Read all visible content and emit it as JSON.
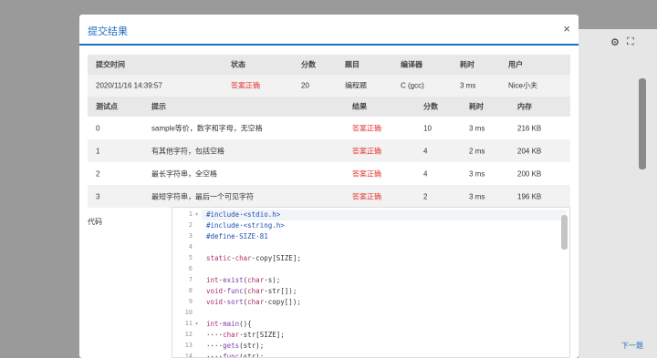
{
  "modal": {
    "title": "提交结果",
    "close": "×"
  },
  "background": {
    "settings_icon": "⚙",
    "fullscreen_icon": "⛶",
    "next_link": "下一题"
  },
  "summary": {
    "headers": [
      "提交时间",
      "状态",
      "分数",
      "题目",
      "编译器",
      "耗时",
      "用户"
    ],
    "values": [
      "2020/11/16 14:39:57",
      "答案正确",
      "20",
      "编程题",
      "C (gcc)",
      "3 ms",
      "Nice小夫"
    ]
  },
  "tests": {
    "headers": [
      "测试点",
      "提示",
      "结果",
      "分数",
      "耗时",
      "内存"
    ],
    "rows": [
      [
        "0",
        "sample等价，数字和字母，无空格",
        "答案正确",
        "10",
        "3 ms",
        "216 KB"
      ],
      [
        "1",
        "有其他字符，包括空格",
        "答案正确",
        "4",
        "2 ms",
        "204 KB"
      ],
      [
        "2",
        "最长字符串，全空格",
        "答案正确",
        "4",
        "3 ms",
        "200 KB"
      ],
      [
        "3",
        "最短字符串，最后一个可见字符",
        "答案正确",
        "2",
        "3 ms",
        "196 KB"
      ]
    ]
  },
  "code_label": "代码",
  "code_lines": [
    {
      "n": "1",
      "fold": "▾",
      "t": "#include·<stdio.h>"
    },
    {
      "n": "2",
      "fold": "",
      "t": "#include·<string.h>"
    },
    {
      "n": "3",
      "fold": "",
      "t": "#define·SIZE·81"
    },
    {
      "n": "4",
      "fold": "",
      "t": ""
    },
    {
      "n": "5",
      "fold": "",
      "t": "static·char·copy[SIZE];"
    },
    {
      "n": "6",
      "fold": "",
      "t": ""
    },
    {
      "n": "7",
      "fold": "",
      "t": "int·exist(char·s);"
    },
    {
      "n": "8",
      "fold": "",
      "t": "void·func(char·str[]);"
    },
    {
      "n": "9",
      "fold": "",
      "t": "void·sort(char·copy[]);"
    },
    {
      "n": "10",
      "fold": "",
      "t": ""
    },
    {
      "n": "11",
      "fold": "▾",
      "t": "int·main(){"
    },
    {
      "n": "12",
      "fold": "",
      "t": "····char·str[SIZE];"
    },
    {
      "n": "13",
      "fold": "",
      "t": "····gets(str);"
    },
    {
      "n": "14",
      "fold": "",
      "t": "····func(str);"
    }
  ]
}
